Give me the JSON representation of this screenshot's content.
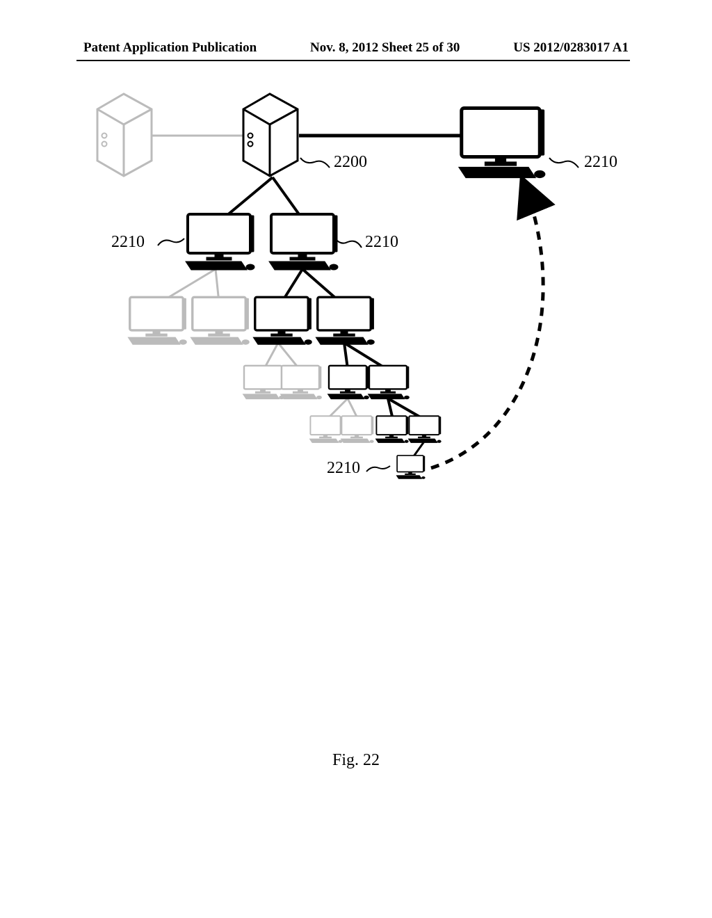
{
  "header": {
    "left": "Patent Application Publication",
    "center": "Nov. 8, 2012  Sheet 25 of 30",
    "right": "US 2012/0283017 A1"
  },
  "figure_caption": "Fig. 22",
  "labels": {
    "server_main": "2200",
    "client_a": "2210",
    "client_b": "2210",
    "client_c": "2210",
    "client_d": "2210"
  },
  "chart_data": {
    "type": "diagram",
    "title": "Network topology — binary-tree client hierarchy under server",
    "nodes": [
      {
        "id": "serverL",
        "kind": "server-tower",
        "emphasis": "grey"
      },
      {
        "id": "serverM",
        "kind": "server-tower",
        "emphasis": "black",
        "ref": "2200"
      },
      {
        "id": "pcTopR",
        "kind": "desktop",
        "emphasis": "black",
        "ref": "2210"
      },
      {
        "id": "pcL1a",
        "kind": "desktop",
        "emphasis": "black",
        "ref": "2210"
      },
      {
        "id": "pcL1b",
        "kind": "desktop",
        "emphasis": "black",
        "ref": "2210"
      },
      {
        "id": "pcL2a",
        "kind": "desktop",
        "emphasis": "grey"
      },
      {
        "id": "pcL2b",
        "kind": "desktop",
        "emphasis": "grey"
      },
      {
        "id": "pcL2c",
        "kind": "desktop",
        "emphasis": "black"
      },
      {
        "id": "pcL2d",
        "kind": "desktop",
        "emphasis": "black"
      },
      {
        "id": "pcL3a",
        "kind": "desktop",
        "emphasis": "grey"
      },
      {
        "id": "pcL3b",
        "kind": "desktop",
        "emphasis": "grey"
      },
      {
        "id": "pcL3c",
        "kind": "desktop",
        "emphasis": "black"
      },
      {
        "id": "pcL3d",
        "kind": "desktop",
        "emphasis": "black"
      },
      {
        "id": "pcL4a",
        "kind": "desktop",
        "emphasis": "grey"
      },
      {
        "id": "pcL4b",
        "kind": "desktop",
        "emphasis": "grey"
      },
      {
        "id": "pcL4c",
        "kind": "desktop",
        "emphasis": "black"
      },
      {
        "id": "pcL4d",
        "kind": "desktop",
        "emphasis": "black"
      },
      {
        "id": "pcL5",
        "kind": "desktop",
        "emphasis": "black",
        "ref": "2210"
      }
    ],
    "edges": [
      {
        "from": "serverL",
        "to": "serverM",
        "style": "grey"
      },
      {
        "from": "serverM",
        "to": "pcTopR",
        "style": "black"
      },
      {
        "from": "serverM",
        "to": "pcL1a",
        "style": "black"
      },
      {
        "from": "serverM",
        "to": "pcL1b",
        "style": "black"
      },
      {
        "from": "pcL1a",
        "to": "pcL2a",
        "style": "grey"
      },
      {
        "from": "pcL1a",
        "to": "pcL2b",
        "style": "grey"
      },
      {
        "from": "pcL1b",
        "to": "pcL2c",
        "style": "black"
      },
      {
        "from": "pcL1b",
        "to": "pcL2d",
        "style": "black"
      },
      {
        "from": "pcL2c",
        "to": "pcL3a",
        "style": "grey"
      },
      {
        "from": "pcL2c",
        "to": "pcL3b",
        "style": "grey"
      },
      {
        "from": "pcL2d",
        "to": "pcL3c",
        "style": "black"
      },
      {
        "from": "pcL2d",
        "to": "pcL3d",
        "style": "black"
      },
      {
        "from": "pcL3c",
        "to": "pcL4a",
        "style": "grey"
      },
      {
        "from": "pcL3c",
        "to": "pcL4b",
        "style": "grey"
      },
      {
        "from": "pcL3d",
        "to": "pcL4c",
        "style": "black"
      },
      {
        "from": "pcL3d",
        "to": "pcL4d",
        "style": "black"
      },
      {
        "from": "pcL4d",
        "to": "pcL5",
        "style": "black"
      },
      {
        "from": "pcL5",
        "to": "pcTopR",
        "style": "dashed-arrow"
      }
    ]
  }
}
